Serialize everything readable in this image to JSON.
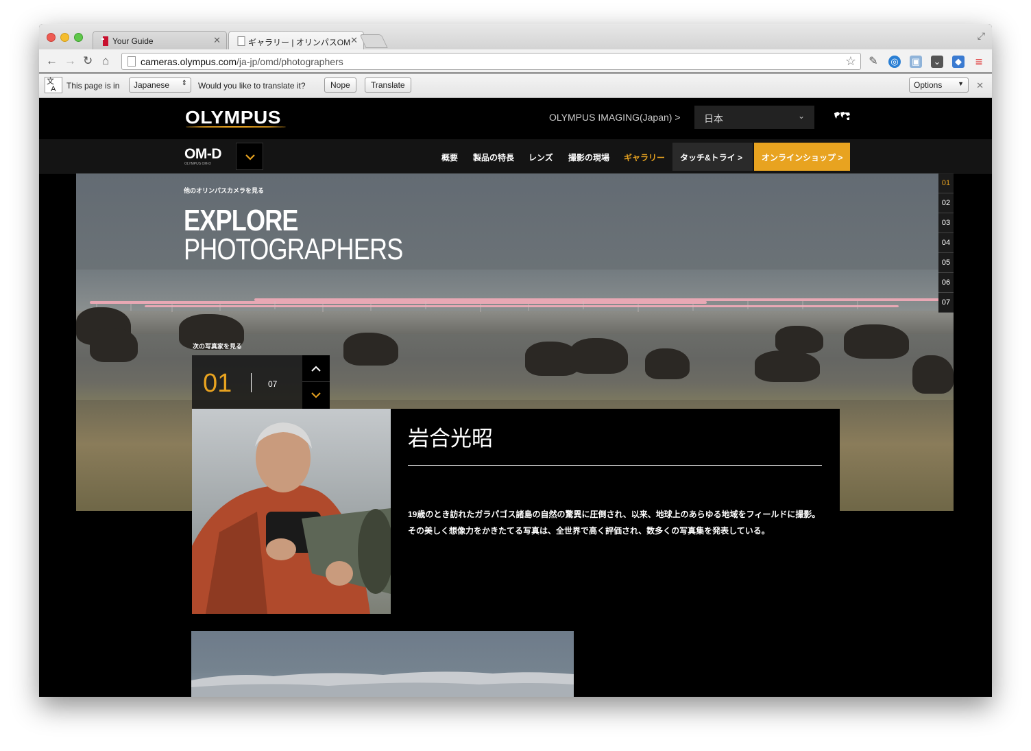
{
  "browser": {
    "tabs": [
      {
        "title": "Your Guide"
      },
      {
        "title": "ギャラリー | オリンパスOM"
      }
    ],
    "url_host": "cameras.olympus.com",
    "url_path": "/ja-jp/omd/photographers",
    "translate_bar": {
      "prefix": "This page is in",
      "language": "Japanese",
      "question": "Would you like to translate it?",
      "nope": "Nope",
      "translate": "Translate",
      "options": "Options"
    }
  },
  "site": {
    "brand": "OLYMPUS",
    "imaging_link": "OLYMPUS IMAGING(Japan) >",
    "country": "日本",
    "product_logo": "OM-D",
    "product_logo_sub": "OLYMPUS OM-D",
    "nav": [
      {
        "label": "概要"
      },
      {
        "label": "製品の特長"
      },
      {
        "label": "レンズ"
      },
      {
        "label": "撮影の現場"
      },
      {
        "label": "ギャラリー"
      }
    ],
    "touch_try": "タッチ&トライ >",
    "online_shop": "オンラインショップ >"
  },
  "hero": {
    "sub_label": "他のオリンパスカメラを見る",
    "title_line1": "EXPLORE",
    "title_line2": "PHOTOGRAPHERS",
    "next_label": "次の写真家を見る",
    "counter_current": "01",
    "counter_total": "07",
    "pager": [
      "01",
      "02",
      "03",
      "04",
      "05",
      "06",
      "07"
    ]
  },
  "profile": {
    "name": "岩合光昭",
    "bio": "19歳のとき訪れたガラパゴス諸島の自然の驚異に圧倒され、以来、地球上のあらゆる地域をフィールドに撮影。 その美しく想像力をかきたてる写真は、全世界で高く評価され、数多くの写真集を発表している。"
  },
  "colors": {
    "accent": "#e8a320",
    "background": "#000000"
  }
}
